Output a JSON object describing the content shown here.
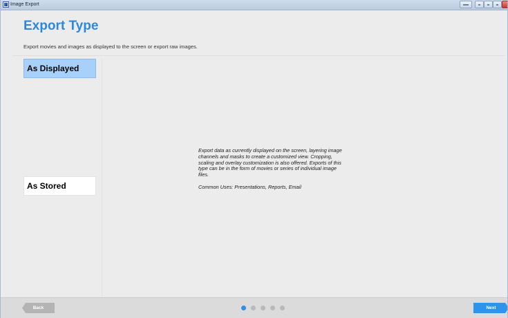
{
  "window": {
    "title": "Image Export",
    "icon": "app-icon",
    "controls": [
      "restore-icon",
      "minimize-icon",
      "maximize-icon",
      "help-icon",
      "close-icon"
    ]
  },
  "header": {
    "title": "Export Type",
    "subtitle": "Export movies and images as displayed to the screen or export raw images."
  },
  "options": [
    {
      "label": "As Displayed",
      "selected": true
    },
    {
      "label": "As Stored",
      "selected": false
    }
  ],
  "description": {
    "line_1": "Export data as currently displayed on the screen, layering image",
    "line_2": "channels and masks to create a customized view.  Cropping,",
    "line_3": "scaling and overlay customization is also offered.  Exports of this",
    "line_4": "type can be in the form of movies or series of individual image",
    "line_5": "files.",
    "common_uses": "Common Uses:  Presentations, Reports, Email"
  },
  "footer": {
    "back_label": "Back",
    "next_label": "Next",
    "pager": {
      "total_steps": 5,
      "current_step": 1
    }
  },
  "colors": {
    "accent": "#2e88d9",
    "selected_option": "#a7d1fb",
    "next_button": "#2e93ea",
    "back_button": "#b4b4b4",
    "inactive_dot": "#b9b9b9"
  }
}
